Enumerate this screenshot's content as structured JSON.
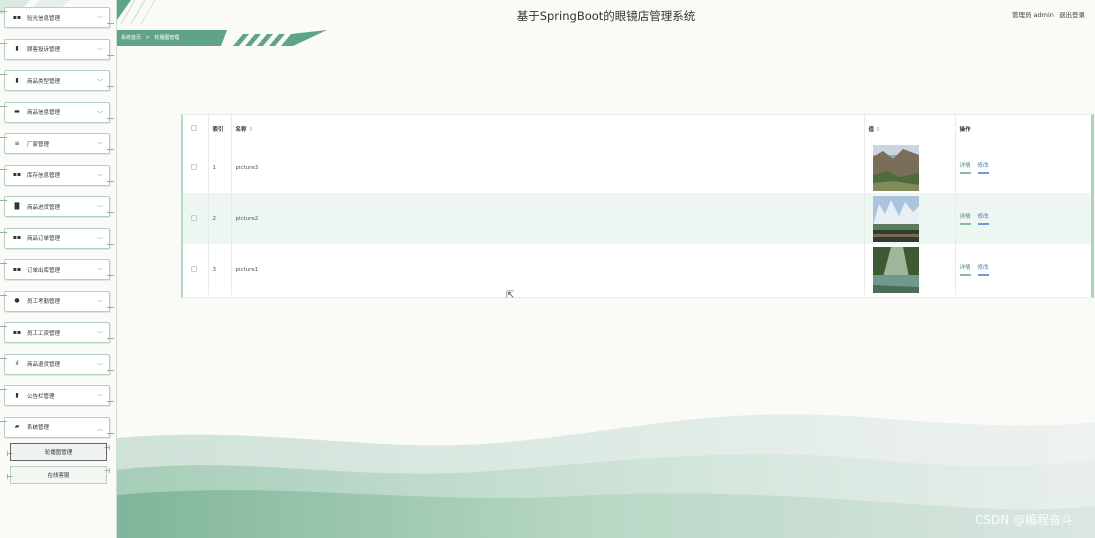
{
  "header": {
    "title": "基于SpringBoot的眼镜店管理系统",
    "user_label": "管理员 admin",
    "logout_label": "退出登录"
  },
  "breadcrumb": {
    "home": "系统首页",
    "separator": ">",
    "current": "轮播图管理"
  },
  "sidebar": {
    "items": [
      {
        "label": "验光信息管理",
        "icon": "grid-icon",
        "glyph": "▪▪"
      },
      {
        "label": "顾客投诉管理",
        "icon": "bag-icon",
        "glyph": "▮"
      },
      {
        "label": "商品类型管理",
        "icon": "bag-icon",
        "glyph": "▮"
      },
      {
        "label": "商品信息管理",
        "icon": "monitor-icon",
        "glyph": "▬"
      },
      {
        "label": "厂家管理",
        "icon": "list-icon",
        "glyph": "≡"
      },
      {
        "label": "库存信息管理",
        "icon": "grid-icon",
        "glyph": "▪▪"
      },
      {
        "label": "商品进货管理",
        "icon": "bars-icon",
        "glyph": "▐▌"
      },
      {
        "label": "商品订单管理",
        "icon": "grid-icon",
        "glyph": "▪▪"
      },
      {
        "label": "订单出库管理",
        "icon": "grid-icon",
        "glyph": "▪▪"
      },
      {
        "label": "员工考勤管理",
        "icon": "user-icon",
        "glyph": "●"
      },
      {
        "label": "员工工资管理",
        "icon": "grid-icon",
        "glyph": "▪▪"
      },
      {
        "label": "商品退货管理",
        "icon": "chart-icon",
        "glyph": "ıl"
      },
      {
        "label": "公告栏管理",
        "icon": "bag-icon",
        "glyph": "▮"
      },
      {
        "label": "系统管理",
        "icon": "folder-icon",
        "glyph": "▰"
      }
    ],
    "sub_items": [
      {
        "label": "轮播图管理",
        "active": true
      },
      {
        "label": "在线客服",
        "active": false
      }
    ]
  },
  "table": {
    "columns": {
      "index": "索引",
      "name": "名称",
      "value": "值",
      "actions": "操作"
    },
    "rows": [
      {
        "index": "1",
        "name": "picture3"
      },
      {
        "index": "2",
        "name": "picture2"
      },
      {
        "index": "3",
        "name": "picture1"
      }
    ],
    "action_detail": "详情",
    "action_edit": "修改"
  },
  "watermark": "CSDN @编程奋斗"
}
